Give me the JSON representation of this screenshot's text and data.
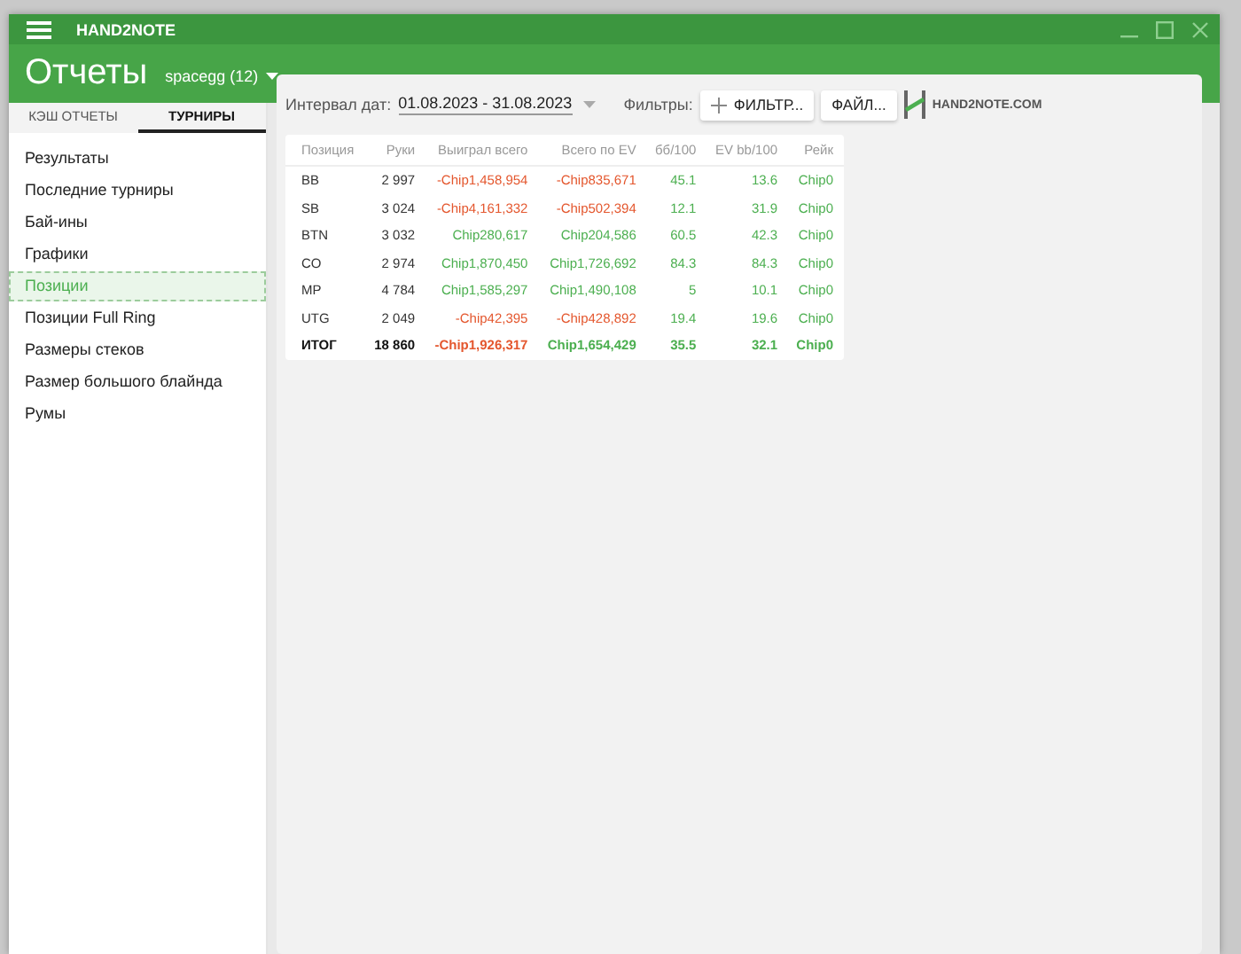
{
  "window": {
    "title": "HAND2NOTE"
  },
  "header": {
    "title": "Отчеты",
    "account": "spacegg (12)"
  },
  "tabs": [
    {
      "label": "КЭШ ОТЧЕТЫ",
      "selected": false
    },
    {
      "label": "ТУРНИРЫ",
      "selected": true
    }
  ],
  "sidebar": {
    "items": [
      {
        "label": "Результаты",
        "selected": false
      },
      {
        "label": "Последние турниры",
        "selected": false
      },
      {
        "label": "Бай-ины",
        "selected": false
      },
      {
        "label": "Графики",
        "selected": false
      },
      {
        "label": "Позиции",
        "selected": true
      },
      {
        "label": "Позиции Full Ring",
        "selected": false
      },
      {
        "label": "Размеры стеков",
        "selected": false
      },
      {
        "label": "Размер большого блайнда",
        "selected": false
      },
      {
        "label": "Румы",
        "selected": false
      }
    ]
  },
  "toolbar": {
    "date_label": "Интервал дат:",
    "date_value": "01.08.2023 - 31.08.2023",
    "filters_label": "Фильтры:",
    "filter_button": "ФИЛЬТР...",
    "file_button": "ФАЙЛ...",
    "logo": "HAND2NOTE.COM"
  },
  "table": {
    "columns": [
      "Позиция",
      "Руки",
      "Выиграл всего",
      "Всего по EV",
      "бб/100",
      "EV bb/100",
      "Рейк"
    ],
    "rows": [
      {
        "total": false,
        "cells": [
          {
            "text": "BB",
            "color": "#333333"
          },
          {
            "text": "2 997",
            "color": "#333333"
          },
          {
            "text": "-Chip1,458,954",
            "color": "#e4572e"
          },
          {
            "text": "-Chip835,671",
            "color": "#e4572e"
          },
          {
            "text": "45.1",
            "color": "#4caf50"
          },
          {
            "text": "13.6",
            "color": "#4caf50"
          },
          {
            "text": "Chip0",
            "color": "#4caf50"
          }
        ]
      },
      {
        "total": false,
        "cells": [
          {
            "text": "SB",
            "color": "#333333"
          },
          {
            "text": "3 024",
            "color": "#333333"
          },
          {
            "text": "-Chip4,161,332",
            "color": "#e4572e"
          },
          {
            "text": "-Chip502,394",
            "color": "#e4572e"
          },
          {
            "text": "12.1",
            "color": "#4caf50"
          },
          {
            "text": "31.9",
            "color": "#4caf50"
          },
          {
            "text": "Chip0",
            "color": "#4caf50"
          }
        ]
      },
      {
        "total": false,
        "cells": [
          {
            "text": "BTN",
            "color": "#333333"
          },
          {
            "text": "3 032",
            "color": "#333333"
          },
          {
            "text": "Chip280,617",
            "color": "#4caf50"
          },
          {
            "text": "Chip204,586",
            "color": "#4caf50"
          },
          {
            "text": "60.5",
            "color": "#4caf50"
          },
          {
            "text": "42.3",
            "color": "#4caf50"
          },
          {
            "text": "Chip0",
            "color": "#4caf50"
          }
        ]
      },
      {
        "total": false,
        "cells": [
          {
            "text": "CO",
            "color": "#333333"
          },
          {
            "text": "2 974",
            "color": "#333333"
          },
          {
            "text": "Chip1,870,450",
            "color": "#4caf50"
          },
          {
            "text": "Chip1,726,692",
            "color": "#4caf50"
          },
          {
            "text": "84.3",
            "color": "#4caf50"
          },
          {
            "text": "84.3",
            "color": "#4caf50"
          },
          {
            "text": "Chip0",
            "color": "#4caf50"
          }
        ]
      },
      {
        "total": false,
        "cells": [
          {
            "text": "MP",
            "color": "#333333"
          },
          {
            "text": "4 784",
            "color": "#333333"
          },
          {
            "text": "Chip1,585,297",
            "color": "#4caf50"
          },
          {
            "text": "Chip1,490,108",
            "color": "#4caf50"
          },
          {
            "text": "5",
            "color": "#4caf50"
          },
          {
            "text": "10.1",
            "color": "#4caf50"
          },
          {
            "text": "Chip0",
            "color": "#4caf50"
          }
        ]
      },
      {
        "total": false,
        "cells": [
          {
            "text": "UTG",
            "color": "#333333"
          },
          {
            "text": "2 049",
            "color": "#333333"
          },
          {
            "text": "-Chip42,395",
            "color": "#e4572e"
          },
          {
            "text": "-Chip428,892",
            "color": "#e4572e"
          },
          {
            "text": "19.4",
            "color": "#4caf50"
          },
          {
            "text": "19.6",
            "color": "#4caf50"
          },
          {
            "text": "Chip0",
            "color": "#4caf50"
          }
        ]
      },
      {
        "total": true,
        "cells": [
          {
            "text": "ИТОГ",
            "color": "#111111"
          },
          {
            "text": "18 860",
            "color": "#111111"
          },
          {
            "text": "-Chip1,926,317",
            "color": "#e4572e"
          },
          {
            "text": "Chip1,654,429",
            "color": "#4caf50"
          },
          {
            "text": "35.5",
            "color": "#4caf50"
          },
          {
            "text": "32.1",
            "color": "#4caf50"
          },
          {
            "text": "Chip0",
            "color": "#4caf50"
          }
        ]
      }
    ]
  }
}
